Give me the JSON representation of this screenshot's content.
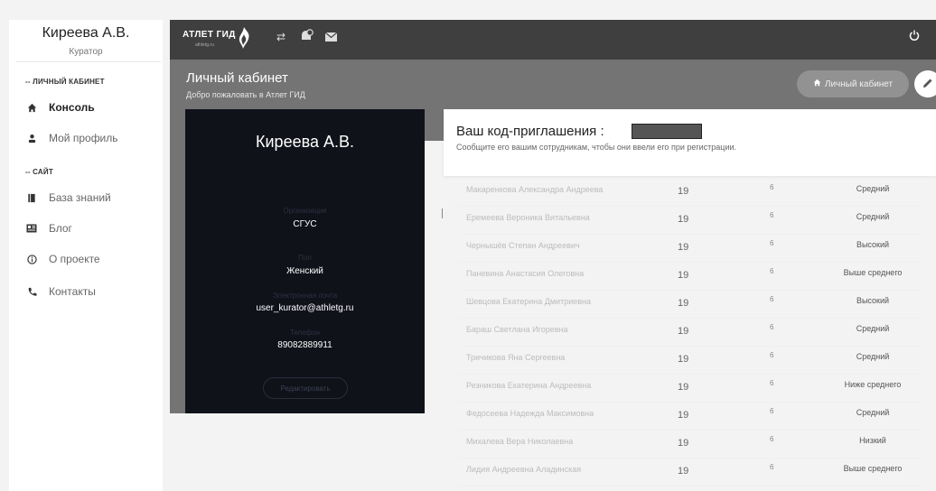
{
  "sidebar": {
    "user_name": "Киреева А.В.",
    "user_role": "Куратор",
    "sections": [
      {
        "label": "-- ЛИЧНЫЙ КАБИНЕТ"
      },
      {
        "label": "-- САЙТ"
      }
    ],
    "items": [
      {
        "label": "Консоль",
        "icon": "home-icon",
        "active": true
      },
      {
        "label": "Мой профиль",
        "icon": "user-icon"
      },
      {
        "label": "База знаний",
        "icon": "book-icon"
      },
      {
        "label": "Блог",
        "icon": "news-icon"
      },
      {
        "label": "О проекте",
        "icon": "info-icon"
      },
      {
        "label": "Контакты",
        "icon": "phone-icon"
      }
    ]
  },
  "topbar": {
    "logo_text": "АТЛЕТ ГИД",
    "logo_sub": "athletg.ru"
  },
  "header": {
    "title": "Личный кабинет",
    "subtitle": "Добро пожаловать в Атлет ГИД",
    "breadcrumb": "Личный кабинет"
  },
  "profile": {
    "name": "Киреева А.В.",
    "fields": [
      {
        "label": "Организация",
        "value": "СГУС"
      },
      {
        "label": "Пол",
        "value": "Женский"
      },
      {
        "label": "Электронная почта",
        "value": "user_kurator@athletg.ru"
      },
      {
        "label": "Телефон",
        "value": "89082889911"
      }
    ],
    "edit_button": "Редактировать"
  },
  "invite": {
    "title": "Ваш код-приглашения :",
    "subtitle": "Сообщите его вашим сотрудникам, чтобы они ввели его при регистрации."
  },
  "table": {
    "rows": [
      {
        "name": "Макаренкова Александра Андреева",
        "age": "19",
        "num": "6",
        "level": "Средний"
      },
      {
        "name": "Еремеева Вероника Витальевна",
        "age": "19",
        "num": "6",
        "level": "Средний"
      },
      {
        "name": "Чернышёв Степан Андреевич",
        "age": "19",
        "num": "6",
        "level": "Высокий"
      },
      {
        "name": "Паневина Анастасия Олеговна",
        "age": "19",
        "num": "6",
        "level": "Выше среднего"
      },
      {
        "name": "Шевцова Екатерина Дмитриевна",
        "age": "19",
        "num": "6",
        "level": "Высокий"
      },
      {
        "name": "Бараш Светлана Игоревна",
        "age": "19",
        "num": "6",
        "level": "Средний"
      },
      {
        "name": "Тричикова Яна Сергеевна",
        "age": "19",
        "num": "6",
        "level": "Средний"
      },
      {
        "name": "Резникова Екатерина Андреевна",
        "age": "19",
        "num": "6",
        "level": "Ниже среднего"
      },
      {
        "name": "Федосеева Надежда Максимовна",
        "age": "19",
        "num": "6",
        "level": "Средний"
      },
      {
        "name": "Михалева Вера Николаевна",
        "age": "19",
        "num": "6",
        "level": "Низкий"
      },
      {
        "name": "Лидия Андреевна Аладинская",
        "age": "19",
        "num": "6",
        "level": "Выше среднего"
      }
    ]
  }
}
